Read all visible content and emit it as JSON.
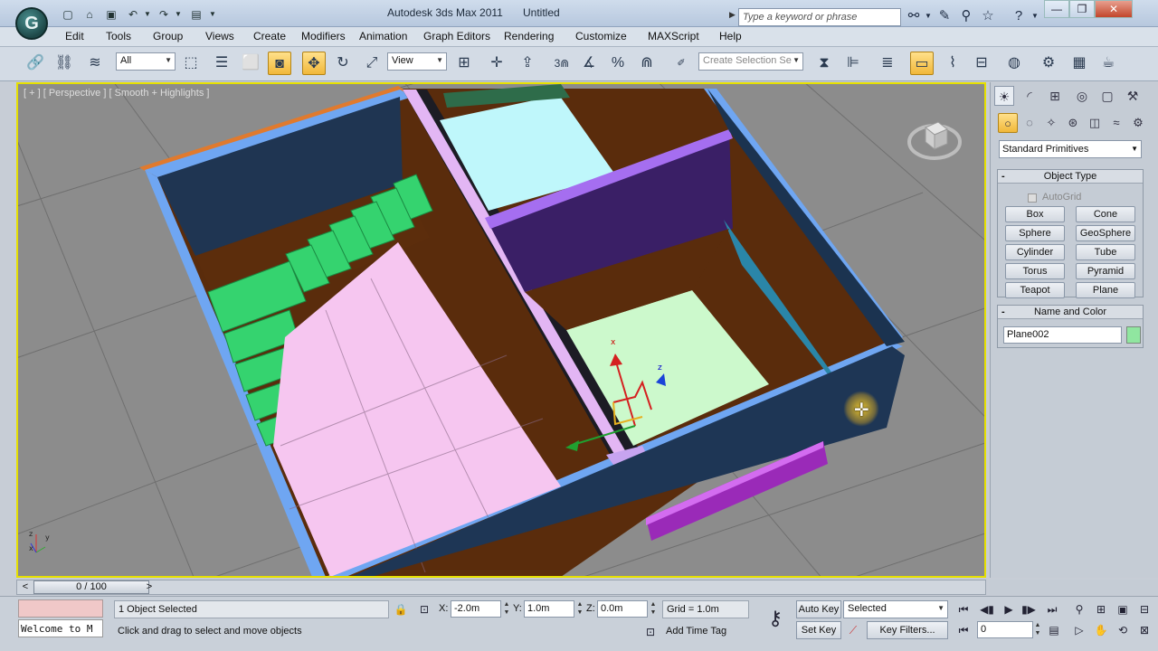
{
  "titlebar": {
    "app_name": "Autodesk 3ds Max 2011",
    "document": "Untitled",
    "search_placeholder": "Type a keyword or phrase",
    "logo_letter": "G"
  },
  "menu": {
    "items": [
      "Edit",
      "Tools",
      "Group",
      "Views",
      "Create",
      "Modifiers",
      "Animation",
      "Graph Editors",
      "Rendering",
      "Customize",
      "MAXScript",
      "Help"
    ]
  },
  "toolbar": {
    "selection_filter": "All",
    "ref_coord": "View",
    "named_selection": "Create Selection Se"
  },
  "viewport": {
    "label": "[ + ] [ Perspective ] [ Smooth + Highlights ]"
  },
  "command_panel": {
    "category": "Standard Primitives",
    "object_type_title": "Object Type",
    "autogrid_label": "AutoGrid",
    "primitives": [
      "Box",
      "Cone",
      "Sphere",
      "GeoSphere",
      "Cylinder",
      "Tube",
      "Torus",
      "Pyramid",
      "Teapot",
      "Plane"
    ],
    "name_color_title": "Name and Color",
    "object_name": "Plane002",
    "object_color": "#90e6a0"
  },
  "timeline": {
    "frame_display": "0 / 100",
    "prev": "<",
    "next": ">"
  },
  "status": {
    "maxscript_text": "Welcome to M",
    "selection_info": "1 Object Selected",
    "prompt": "Click and drag to select and move objects",
    "x_label": "X:",
    "x_value": "-2.0m",
    "y_label": "Y:",
    "y_value": "1.0m",
    "z_label": "Z:",
    "z_value": "0.0m",
    "grid": "Grid = 1.0m",
    "add_time_tag": "Add Time Tag",
    "auto_key": "Auto Key",
    "set_key": "Set Key",
    "key_mode": "Selected",
    "key_filters": "Key Filters...",
    "current_frame": "0"
  }
}
